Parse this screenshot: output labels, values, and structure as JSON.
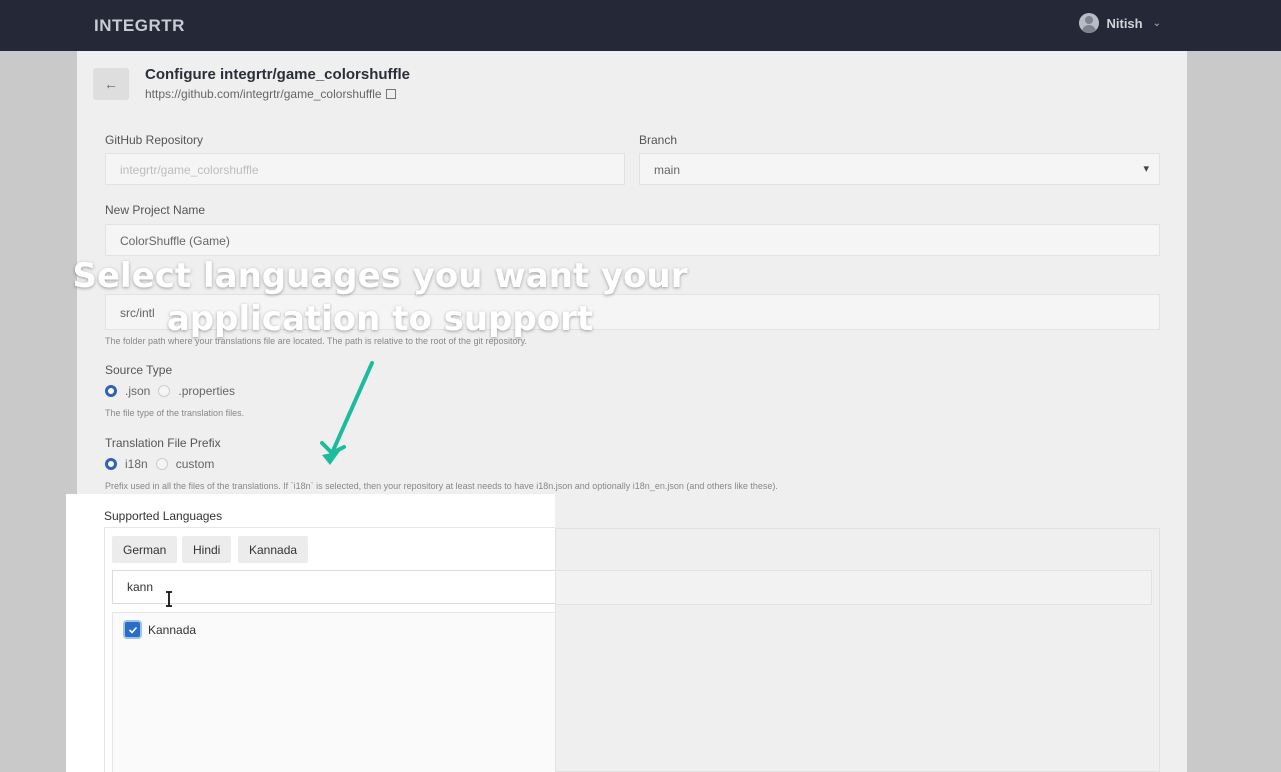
{
  "header": {
    "logo": "INTEGRTR",
    "user_name": "Nitish"
  },
  "page": {
    "title": "Configure integrtr/game_colorshuffle",
    "repo_url": "https://github.com/integrtr/game_colorshuffle"
  },
  "form": {
    "github_repo": {
      "label": "GitHub Repository",
      "value": "integrtr/game_colorshuffle"
    },
    "branch": {
      "label": "Branch",
      "value": "main"
    },
    "project_name": {
      "label": "New Project Name",
      "value": "ColorShuffle (Game)"
    },
    "folder_path": {
      "value": "src/intl",
      "hint": "The folder path where your translations file are located. The path is relative to the root of the git repository."
    },
    "source_type": {
      "label": "Source Type",
      "options": [
        ".json",
        ".properties"
      ],
      "selected": ".json",
      "hint": "The file type of the translation files."
    },
    "file_prefix": {
      "label": "Translation File Prefix",
      "options": [
        "i18n",
        "custom"
      ],
      "selected": "i18n",
      "hint": "Prefix used in all the files of the translations. If `i18n` is selected, then your repository at least needs to have i18n.json and optionally i18n_en.json (and others like these)."
    },
    "supported_languages": {
      "label": "Supported Languages",
      "chips": [
        "German",
        "Hindi",
        "Kannada"
      ],
      "search_value": "kann",
      "results": [
        {
          "label": "Kannada",
          "checked": true
        }
      ]
    }
  },
  "overlay": {
    "line1": "Select languages you want your",
    "line2": "application to support",
    "arrow_color": "#1abc9c"
  },
  "colors": {
    "accent": "#2e63b8",
    "topbar": "#252836"
  }
}
